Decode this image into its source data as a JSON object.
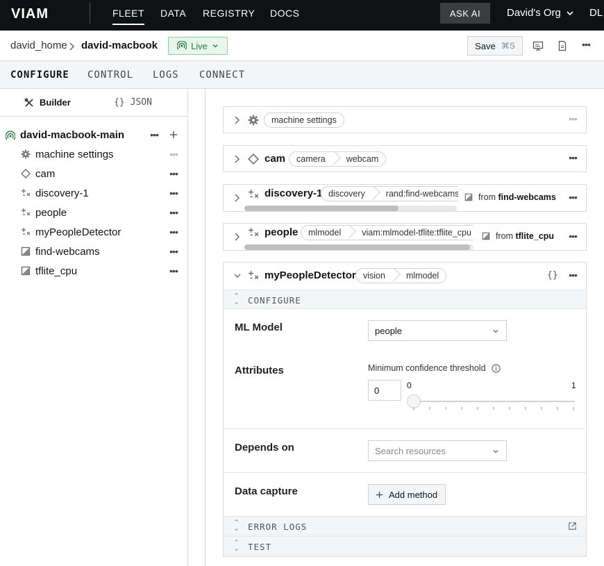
{
  "nav": {
    "brand": "VIAM",
    "items": [
      "FLEET",
      "DATA",
      "REGISTRY",
      "DOCS"
    ],
    "ask_ai": "ASK AI",
    "org": "David's Org",
    "user_initials": "DL"
  },
  "breadcrumb": {
    "location": "david_home",
    "machine": "david-macbook",
    "status": "Live",
    "save_label": "Save",
    "save_shortcut": "⌘S"
  },
  "tabs": [
    "CONFIGURE",
    "CONTROL",
    "LOGS",
    "CONNECT"
  ],
  "sidebar": {
    "mode_tabs": {
      "builder": "Builder",
      "json": "JSON"
    },
    "json_glyph": "{}",
    "machine": "david-macbook-main",
    "items": [
      {
        "label": "machine settings",
        "icon": "gear-icon"
      },
      {
        "label": "cam",
        "icon": "diamond-icon"
      },
      {
        "label": "discovery-1",
        "icon": "sparkle-icon"
      },
      {
        "label": "people",
        "icon": "sparkle-icon"
      },
      {
        "label": "myPeopleDetector",
        "icon": "sparkle-icon"
      },
      {
        "label": "find-webcams",
        "icon": "module-icon"
      },
      {
        "label": "tflite_cpu",
        "icon": "module-icon"
      }
    ]
  },
  "cards": {
    "machine_settings": {
      "tag": "machine settings"
    },
    "cam": {
      "name": "cam",
      "api": "camera",
      "model": "webcam"
    },
    "discovery": {
      "name": "discovery-1",
      "api": "discovery",
      "model": "rand:find-webcams:webcam-discovery",
      "from_prefix": "from",
      "from_module": "find-webcams"
    },
    "people": {
      "name": "people",
      "api": "mlmodel",
      "model": "viam:mlmodel-tflite:tflite_cpu",
      "from_prefix": "from",
      "from_module": "tflite_cpu"
    },
    "detector": {
      "name": "myPeopleDetector",
      "api": "vision",
      "model": "mlmodel",
      "json_glyph": "{}",
      "configure_header": "CONFIGURE",
      "ml_model_label": "ML Model",
      "ml_model_value": "people",
      "attributes_label": "Attributes",
      "threshold_label": "Minimum confidence threshold",
      "threshold_value": "0",
      "slider_min": "0",
      "slider_max": "1",
      "slider_level": 0,
      "depends_label": "Depends on",
      "depends_placeholder": "Search resources",
      "capture_label": "Data capture",
      "add_method": "Add method",
      "error_logs": "ERROR LOGS",
      "test": "TEST"
    }
  }
}
